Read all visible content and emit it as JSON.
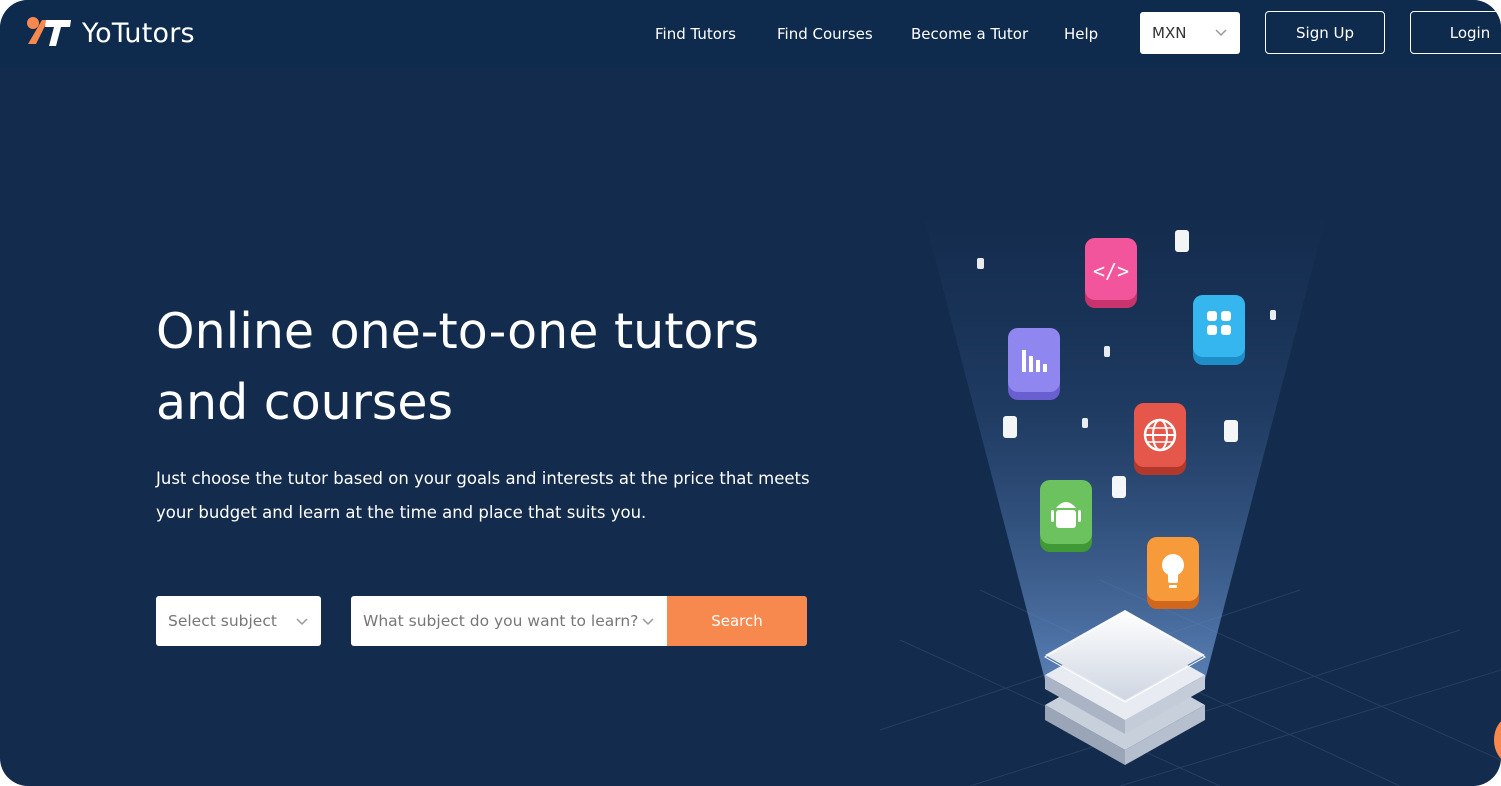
{
  "brand": {
    "name": "YoTutors",
    "accent": "#f7894f",
    "background": "#132b4c",
    "nav_background": "#0e2a4d"
  },
  "nav": {
    "links": [
      "Find Tutors",
      "Find Courses",
      "Become a Tutor",
      "Help"
    ],
    "currency": {
      "selected": "MXN"
    },
    "signup_label": "Sign Up",
    "login_label": "Login"
  },
  "hero": {
    "title_line1": "Online one-to-one tutors",
    "title_line2": "and courses",
    "subtitle_line1": "Just choose the tutor based on your goals and interests at the price that meets",
    "subtitle_line2": "your budget and learn at the time and place that suits you."
  },
  "search": {
    "subject_select_placeholder": "Select subject",
    "query_placeholder": "What subject do you want to learn?",
    "button_label": "Search"
  },
  "illustration": {
    "icons": [
      "code-icon",
      "grid-icon",
      "chart-icon",
      "globe-icon",
      "android-icon",
      "lightbulb-icon"
    ]
  }
}
